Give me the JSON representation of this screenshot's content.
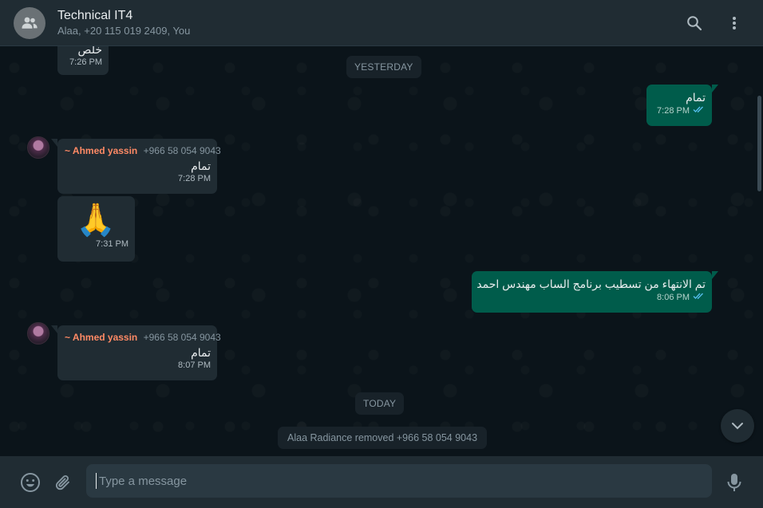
{
  "header": {
    "title": "Technical IT4",
    "subtitle": "Alaa, +20 115 019 2409, You"
  },
  "chat": {
    "partial_top": {
      "text": "خلص",
      "time": "7:26 PM"
    },
    "date_yesterday": "YESTERDAY",
    "date_today": "TODAY",
    "messages": [
      {
        "dir": "out",
        "text": "تمام",
        "time": "7:28 PM"
      },
      {
        "dir": "in",
        "sender": "~ Ahmed yassin",
        "phone": "+966 58 054 9043",
        "text": "تمام",
        "time": "7:28 PM"
      },
      {
        "dir": "in",
        "emoji": "🙏",
        "time": "7:31 PM"
      },
      {
        "dir": "out",
        "text": "تم الانتهاء من تسطيب برنامج الساب مهندس احمد",
        "time": "8:06 PM"
      },
      {
        "dir": "in",
        "sender": "~ Ahmed yassin",
        "phone": "+966 58 054 9043",
        "text": "تمام",
        "time": "8:07 PM"
      }
    ],
    "system_message": "Alaa Radiance removed +966 58 054 9043"
  },
  "composer": {
    "placeholder": "Type a message"
  },
  "icons": {
    "group_avatar": "group-avatar-icon",
    "search": "search-icon",
    "menu": "menu-icon",
    "emoji": "emoji-icon",
    "attach": "attach-icon",
    "mic": "mic-icon",
    "scroll_down": "chevron-down-icon",
    "read_receipt": "double-check-icon"
  },
  "colors": {
    "header_bg": "#202c33",
    "chat_bg": "#0b141a",
    "incoming_bubble": "#202c33",
    "outgoing_bubble": "#005c4b",
    "sender_name": "#ff8a65",
    "read_check": "#53bdeb"
  }
}
